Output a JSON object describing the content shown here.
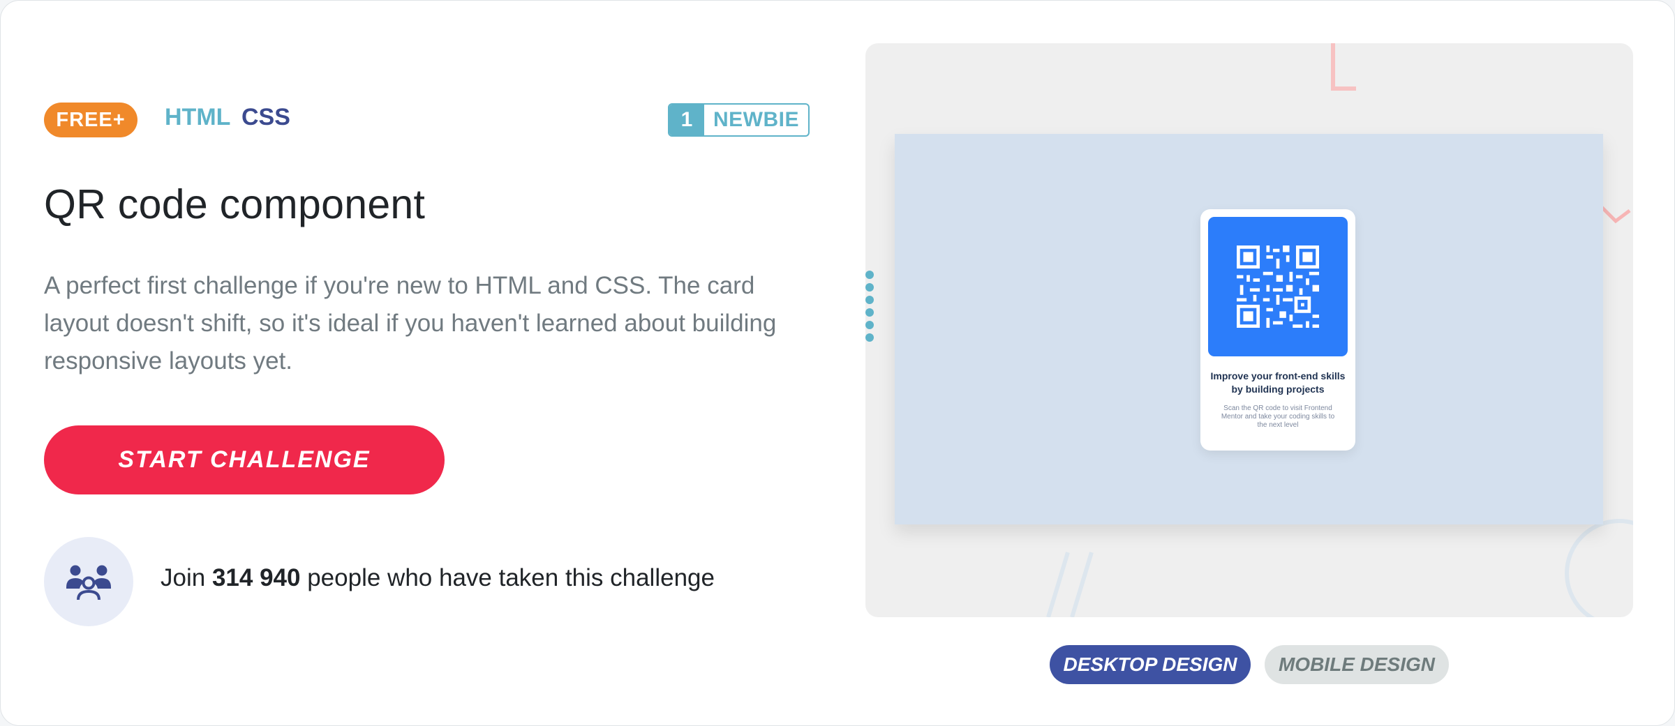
{
  "badges": {
    "tier": "FREE+",
    "languages": [
      "HTML",
      "CSS"
    ],
    "level_number": "1",
    "level_label": "NEWBIE"
  },
  "challenge": {
    "title": "QR code component",
    "description": "A perfect first challenge if you're new to HTML and CSS. The card layout doesn't shift, so it's ideal if you haven't learned about building responsive layouts yet.",
    "start_label": "START CHALLENGE"
  },
  "participants": {
    "prefix": "Join",
    "count": "314 940",
    "suffix": "people who have taken this challenge",
    "icon": "people-group-icon"
  },
  "preview": {
    "qr_card_title": "Improve your front-end skills by building projects",
    "qr_card_text": "Scan the QR code to visit Frontend Mentor and take your coding skills to the next level"
  },
  "design_toggle": {
    "desktop_label": "DESKTOP DESIGN",
    "mobile_label": "MOBILE DESIGN",
    "selected": "DESKTOP DESIGN"
  },
  "colors": {
    "tier_badge": "#f0892a",
    "html_tag": "#5fb3c9",
    "css_tag": "#3b4a8f",
    "primary_button": "#f0284b",
    "desktop_button_active": "#3e52a3",
    "qr_background": "#2c7dfa"
  }
}
